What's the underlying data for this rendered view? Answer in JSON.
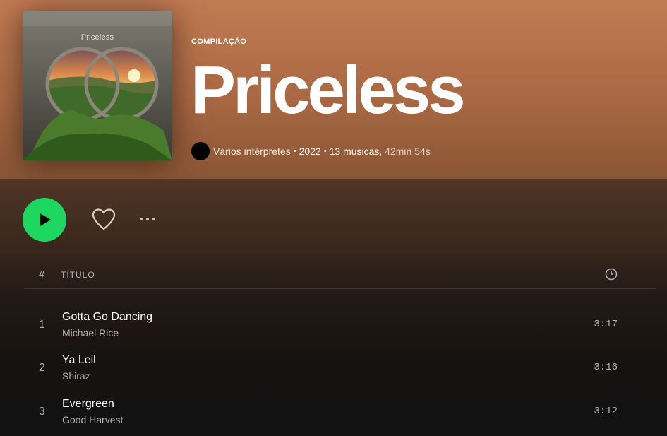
{
  "album": {
    "cover_title": "Priceless",
    "type": "COMPILAÇÃO",
    "title": "Priceless",
    "artist": "Vários intérpretes",
    "year": "2022",
    "track_count": "13 músicas,",
    "duration": "42min 54s"
  },
  "controls": {
    "play_icon": "play-icon",
    "like_icon": "heart-icon",
    "more_icon": "more-icon"
  },
  "table": {
    "header_number": "#",
    "header_title": "TÍTULO",
    "header_duration_icon": "clock-icon"
  },
  "tracks": [
    {
      "number": "1",
      "title": "Gotta Go Dancing",
      "artist": "Michael Rice",
      "duration": "3:17"
    },
    {
      "number": "2",
      "title": "Ya Leil",
      "artist": "Shiraz",
      "duration": "3:16"
    },
    {
      "number": "3",
      "title": "Evergreen",
      "artist": "Good Harvest",
      "duration": "3:12"
    }
  ],
  "colors": {
    "header": "#c17b52",
    "accent": "#1ed760",
    "background": "#121212"
  }
}
